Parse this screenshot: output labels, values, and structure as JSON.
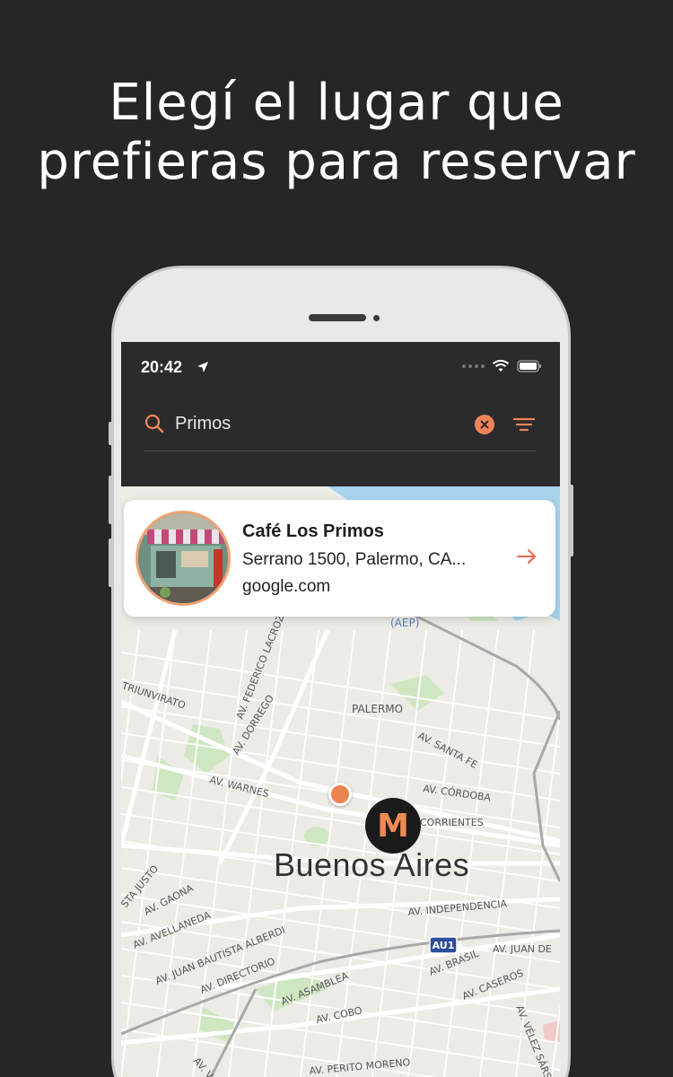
{
  "headline": {
    "line1": "Elegí el lugar que",
    "line2": "prefieras para reservar"
  },
  "status_bar": {
    "time": "20:42"
  },
  "search": {
    "query": "Primos"
  },
  "result": {
    "name": "Café Los Primos",
    "address": "Serrano 1500, Palermo, CA...",
    "source": "google.com"
  },
  "map": {
    "city": "Buenos Aires",
    "brand_marker_letter": "M",
    "labels": {
      "aep": "(AEP)",
      "palermo": "PALERMO",
      "santa_fe": "AV. SANTA FE",
      "cordoba": "AV. CÓRDOBA",
      "corrientes": "CORRIENTES",
      "warnes": "AV. WARNES",
      "dorrego": "AV. DORREGO",
      "lacroze": "AV. FEDERICO LACROZE",
      "triunvirato": "TRIUNVIRATO",
      "justo": "STA JUSTO",
      "gaona": "AV. GAONA",
      "avellaneda": "AV. AVELLANEDA",
      "alberdi": "AV. JUAN BAUTISTA ALBERDI",
      "directorio": "AV. DIRECTORIO",
      "independencia": "AV. INDEPENDENCIA",
      "au1": "AU1",
      "juan_de": "AV. JUAN DE",
      "brasil": "AV. BRASIL",
      "caseros": "AV. CASEROS",
      "asamblea": "AV. ASAMBLEA",
      "cobo": "AV. COBO",
      "varela": "AV. VARELA",
      "perito_moreno": "AV. PERITO MORENO",
      "velez": "AV. VÉLEZ SÁRS"
    }
  },
  "colors": {
    "accent": "#ef8459",
    "background": "#262626",
    "bar": "#2b2b2b"
  }
}
